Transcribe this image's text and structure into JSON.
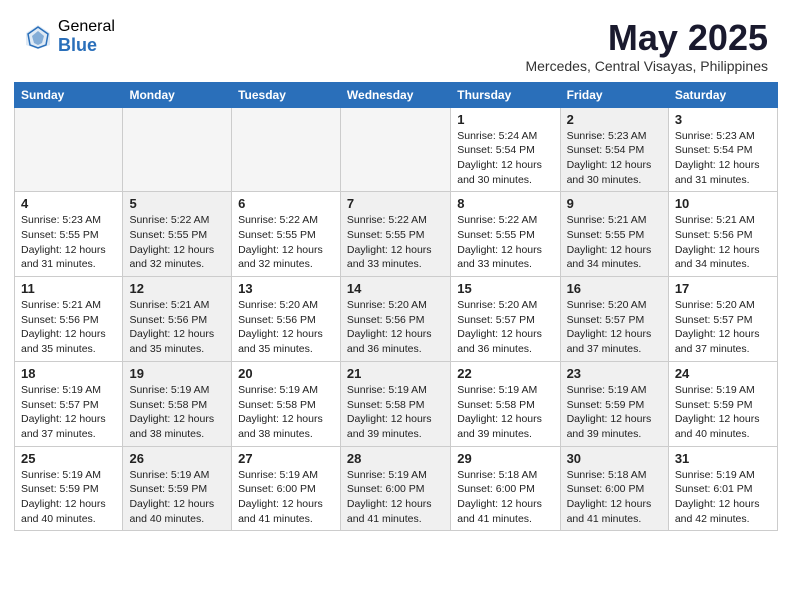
{
  "header": {
    "logo_general": "General",
    "logo_blue": "Blue",
    "month_title": "May 2025",
    "location": "Mercedes, Central Visayas, Philippines"
  },
  "days_of_week": [
    "Sunday",
    "Monday",
    "Tuesday",
    "Wednesday",
    "Thursday",
    "Friday",
    "Saturday"
  ],
  "weeks": [
    [
      {
        "day": "",
        "empty": true,
        "lines": []
      },
      {
        "day": "",
        "empty": true,
        "lines": []
      },
      {
        "day": "",
        "empty": true,
        "lines": []
      },
      {
        "day": "",
        "empty": true,
        "lines": []
      },
      {
        "day": "1",
        "shaded": false,
        "lines": [
          "Sunrise: 5:24 AM",
          "Sunset: 5:54 PM",
          "Daylight: 12 hours",
          "and 30 minutes."
        ]
      },
      {
        "day": "2",
        "shaded": true,
        "lines": [
          "Sunrise: 5:23 AM",
          "Sunset: 5:54 PM",
          "Daylight: 12 hours",
          "and 30 minutes."
        ]
      },
      {
        "day": "3",
        "shaded": false,
        "lines": [
          "Sunrise: 5:23 AM",
          "Sunset: 5:54 PM",
          "Daylight: 12 hours",
          "and 31 minutes."
        ]
      }
    ],
    [
      {
        "day": "4",
        "shaded": false,
        "lines": [
          "Sunrise: 5:23 AM",
          "Sunset: 5:55 PM",
          "Daylight: 12 hours",
          "and 31 minutes."
        ]
      },
      {
        "day": "5",
        "shaded": true,
        "lines": [
          "Sunrise: 5:22 AM",
          "Sunset: 5:55 PM",
          "Daylight: 12 hours",
          "and 32 minutes."
        ]
      },
      {
        "day": "6",
        "shaded": false,
        "lines": [
          "Sunrise: 5:22 AM",
          "Sunset: 5:55 PM",
          "Daylight: 12 hours",
          "and 32 minutes."
        ]
      },
      {
        "day": "7",
        "shaded": true,
        "lines": [
          "Sunrise: 5:22 AM",
          "Sunset: 5:55 PM",
          "Daylight: 12 hours",
          "and 33 minutes."
        ]
      },
      {
        "day": "8",
        "shaded": false,
        "lines": [
          "Sunrise: 5:22 AM",
          "Sunset: 5:55 PM",
          "Daylight: 12 hours",
          "and 33 minutes."
        ]
      },
      {
        "day": "9",
        "shaded": true,
        "lines": [
          "Sunrise: 5:21 AM",
          "Sunset: 5:55 PM",
          "Daylight: 12 hours",
          "and 34 minutes."
        ]
      },
      {
        "day": "10",
        "shaded": false,
        "lines": [
          "Sunrise: 5:21 AM",
          "Sunset: 5:56 PM",
          "Daylight: 12 hours",
          "and 34 minutes."
        ]
      }
    ],
    [
      {
        "day": "11",
        "shaded": false,
        "lines": [
          "Sunrise: 5:21 AM",
          "Sunset: 5:56 PM",
          "Daylight: 12 hours",
          "and 35 minutes."
        ]
      },
      {
        "day": "12",
        "shaded": true,
        "lines": [
          "Sunrise: 5:21 AM",
          "Sunset: 5:56 PM",
          "Daylight: 12 hours",
          "and 35 minutes."
        ]
      },
      {
        "day": "13",
        "shaded": false,
        "lines": [
          "Sunrise: 5:20 AM",
          "Sunset: 5:56 PM",
          "Daylight: 12 hours",
          "and 35 minutes."
        ]
      },
      {
        "day": "14",
        "shaded": true,
        "lines": [
          "Sunrise: 5:20 AM",
          "Sunset: 5:56 PM",
          "Daylight: 12 hours",
          "and 36 minutes."
        ]
      },
      {
        "day": "15",
        "shaded": false,
        "lines": [
          "Sunrise: 5:20 AM",
          "Sunset: 5:57 PM",
          "Daylight: 12 hours",
          "and 36 minutes."
        ]
      },
      {
        "day": "16",
        "shaded": true,
        "lines": [
          "Sunrise: 5:20 AM",
          "Sunset: 5:57 PM",
          "Daylight: 12 hours",
          "and 37 minutes."
        ]
      },
      {
        "day": "17",
        "shaded": false,
        "lines": [
          "Sunrise: 5:20 AM",
          "Sunset: 5:57 PM",
          "Daylight: 12 hours",
          "and 37 minutes."
        ]
      }
    ],
    [
      {
        "day": "18",
        "shaded": false,
        "lines": [
          "Sunrise: 5:19 AM",
          "Sunset: 5:57 PM",
          "Daylight: 12 hours",
          "and 37 minutes."
        ]
      },
      {
        "day": "19",
        "shaded": true,
        "lines": [
          "Sunrise: 5:19 AM",
          "Sunset: 5:58 PM",
          "Daylight: 12 hours",
          "and 38 minutes."
        ]
      },
      {
        "day": "20",
        "shaded": false,
        "lines": [
          "Sunrise: 5:19 AM",
          "Sunset: 5:58 PM",
          "Daylight: 12 hours",
          "and 38 minutes."
        ]
      },
      {
        "day": "21",
        "shaded": true,
        "lines": [
          "Sunrise: 5:19 AM",
          "Sunset: 5:58 PM",
          "Daylight: 12 hours",
          "and 39 minutes."
        ]
      },
      {
        "day": "22",
        "shaded": false,
        "lines": [
          "Sunrise: 5:19 AM",
          "Sunset: 5:58 PM",
          "Daylight: 12 hours",
          "and 39 minutes."
        ]
      },
      {
        "day": "23",
        "shaded": true,
        "lines": [
          "Sunrise: 5:19 AM",
          "Sunset: 5:59 PM",
          "Daylight: 12 hours",
          "and 39 minutes."
        ]
      },
      {
        "day": "24",
        "shaded": false,
        "lines": [
          "Sunrise: 5:19 AM",
          "Sunset: 5:59 PM",
          "Daylight: 12 hours",
          "and 40 minutes."
        ]
      }
    ],
    [
      {
        "day": "25",
        "shaded": false,
        "lines": [
          "Sunrise: 5:19 AM",
          "Sunset: 5:59 PM",
          "Daylight: 12 hours",
          "and 40 minutes."
        ]
      },
      {
        "day": "26",
        "shaded": true,
        "lines": [
          "Sunrise: 5:19 AM",
          "Sunset: 5:59 PM",
          "Daylight: 12 hours",
          "and 40 minutes."
        ]
      },
      {
        "day": "27",
        "shaded": false,
        "lines": [
          "Sunrise: 5:19 AM",
          "Sunset: 6:00 PM",
          "Daylight: 12 hours",
          "and 41 minutes."
        ]
      },
      {
        "day": "28",
        "shaded": true,
        "lines": [
          "Sunrise: 5:19 AM",
          "Sunset: 6:00 PM",
          "Daylight: 12 hours",
          "and 41 minutes."
        ]
      },
      {
        "day": "29",
        "shaded": false,
        "lines": [
          "Sunrise: 5:18 AM",
          "Sunset: 6:00 PM",
          "Daylight: 12 hours",
          "and 41 minutes."
        ]
      },
      {
        "day": "30",
        "shaded": true,
        "lines": [
          "Sunrise: 5:18 AM",
          "Sunset: 6:00 PM",
          "Daylight: 12 hours",
          "and 41 minutes."
        ]
      },
      {
        "day": "31",
        "shaded": false,
        "lines": [
          "Sunrise: 5:19 AM",
          "Sunset: 6:01 PM",
          "Daylight: 12 hours",
          "and 42 minutes."
        ]
      }
    ]
  ]
}
